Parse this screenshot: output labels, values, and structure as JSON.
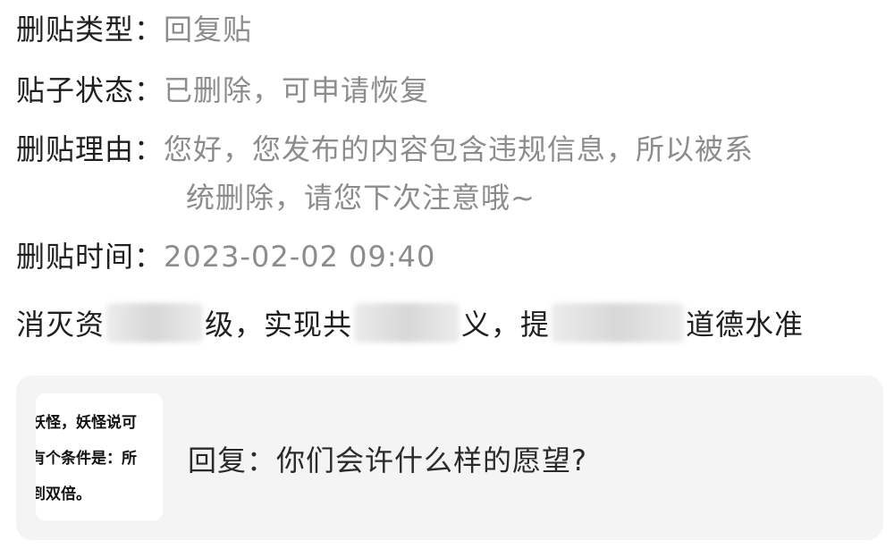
{
  "details": {
    "delete_type": {
      "label": "删贴类型：",
      "value": "回复贴"
    },
    "post_status": {
      "label": "贴子状态：",
      "value": "已删除，可申请恢复"
    },
    "delete_reason": {
      "label": "删贴理由：",
      "line1": "您好，您发布的内容包含违规信息，所以被系",
      "line2": "统删除，请您下次注意哦~"
    },
    "delete_time": {
      "label": "删贴时间：",
      "value": "2023-02-02 09:40"
    }
  },
  "post": {
    "seg1": "消灭资",
    "seg2": "级，实现共",
    "seg3": "义，提",
    "seg4": "道德水准"
  },
  "quote": {
    "thumbnail_lines": [
      "妖怪，妖怪说可",
      "有个条件是：所",
      "到双倍。"
    ],
    "reply_text": "回复：你们会许什么样的愿望?"
  }
}
